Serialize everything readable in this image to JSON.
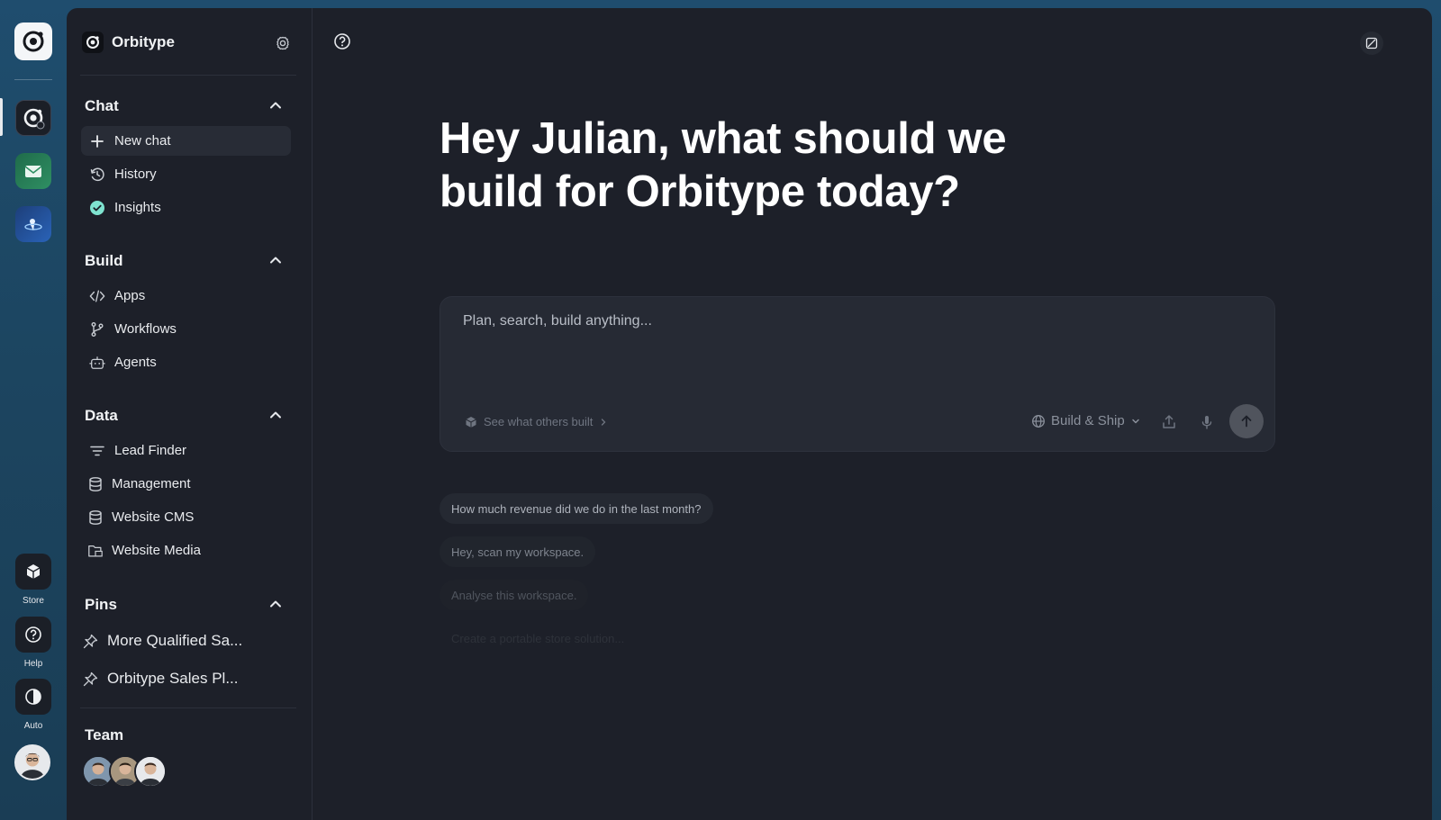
{
  "rail": {
    "store_label": "Store",
    "help_label": "Help",
    "theme_label": "Auto"
  },
  "sidebar": {
    "brand_name": "Orbitype",
    "sections": {
      "chat": {
        "title": "Chat",
        "items": [
          "New chat",
          "History",
          "Insights"
        ]
      },
      "build": {
        "title": "Build",
        "items": [
          "Apps",
          "Workflows",
          "Agents"
        ]
      },
      "data": {
        "title": "Data",
        "items": [
          "Lead Finder",
          "Management",
          "Website CMS",
          "Website Media"
        ]
      },
      "pins": {
        "title": "Pins",
        "items": [
          "More Qualified Sa...",
          "Orbitype Sales Pl..."
        ]
      },
      "team": {
        "title": "Team"
      }
    }
  },
  "main": {
    "greeting": "Hey Julian, what should we build for Orbitype today?",
    "composer": {
      "placeholder": "Plan, search, build anything...",
      "see_others": "See what others built",
      "mode": "Build & Ship"
    },
    "suggestions": [
      "How much revenue did we do in the last month?",
      "Hey, scan my workspace.",
      "Analyse this workspace.",
      "Create a portable store solution..."
    ]
  },
  "colors": {
    "panel_bg": "#1d2029",
    "composer_bg": "#262a34",
    "insights_check": "#7fe3d0",
    "rail_gradient_top": "#1f4d6e"
  }
}
